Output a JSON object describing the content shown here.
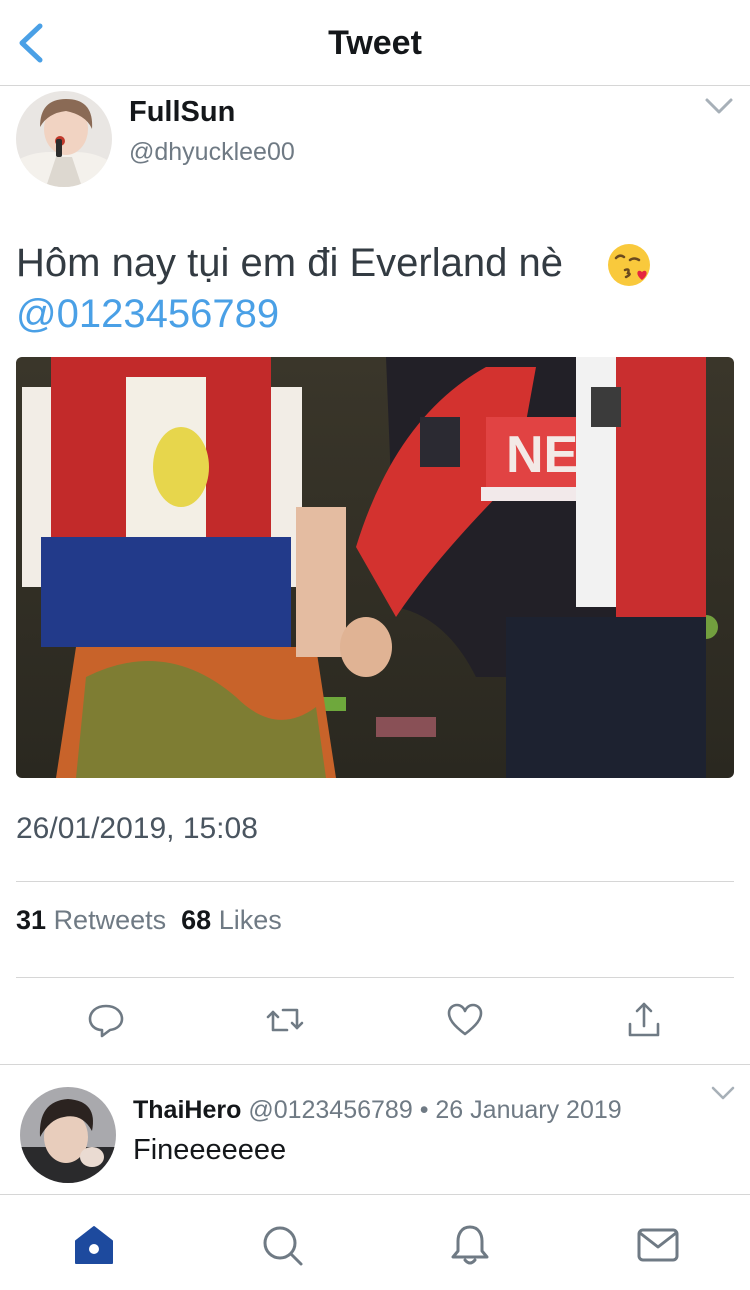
{
  "header": {
    "title": "Tweet",
    "back_icon": "chevron-left-icon"
  },
  "tweet": {
    "author_name": "FullSun",
    "author_handle": "@dhyucklee00",
    "text": "Hôm nay tụi em đi Everland nè",
    "emoji": "kissing-face-with-heart-emoji",
    "mention": "@0123456789",
    "timestamp": "26/01/2019, 15:08",
    "retweets_count": "31",
    "retweets_label": "Retweets",
    "likes_count": "68",
    "likes_label": "Likes"
  },
  "actions": [
    "reply-icon",
    "retweet-icon",
    "like-icon",
    "share-icon"
  ],
  "reply": {
    "name": "ThaiHero",
    "handle": "@0123456789",
    "date": "26 January 2019",
    "text": "Fineeeeeee"
  },
  "tabbar": [
    "home-icon",
    "search-icon",
    "notifications-icon",
    "messages-icon"
  ],
  "colors": {
    "accent": "#4aa0e6",
    "nav_active": "#1d4a9e",
    "icon_gray": "#6f7a84"
  }
}
